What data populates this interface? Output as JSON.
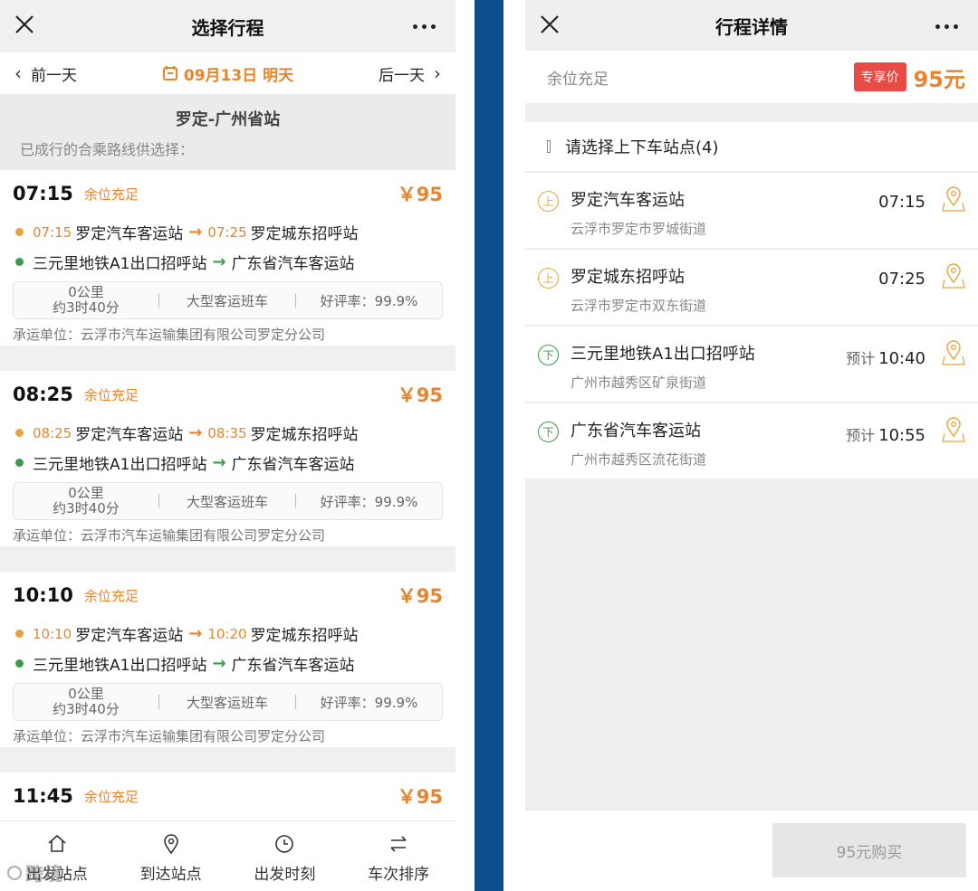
{
  "left": {
    "title": "选择行程",
    "prev_day": "前一天",
    "next_day": "后一天",
    "date": "09月13日 明天",
    "route_title": "罗定-广州省站",
    "route_hint": "已成行的合乘路线供选择：",
    "trips": [
      {
        "time": "07:15",
        "availability": "余位充足",
        "price": "￥95",
        "from_time": "07:15",
        "from": "罗定汽车客运站",
        "mid_time": "07:25",
        "mid": "罗定城东招呼站",
        "drop1": "三元里地铁A1出口招呼站",
        "drop2": "广东省汽车客运站",
        "distance": "0公里",
        "duration": "约3时40分",
        "bus_type": "大型客运班车",
        "rating": "好评率：99.9%",
        "carrier": "承运单位：云浮市汽车运输集团有限公司罗定分公司"
      },
      {
        "time": "08:25",
        "availability": "余位充足",
        "price": "￥95",
        "from_time": "08:25",
        "from": "罗定汽车客运站",
        "mid_time": "08:35",
        "mid": "罗定城东招呼站",
        "drop1": "三元里地铁A1出口招呼站",
        "drop2": "广东省汽车客运站",
        "distance": "0公里",
        "duration": "约3时40分",
        "bus_type": "大型客运班车",
        "rating": "好评率：99.9%",
        "carrier": "承运单位：云浮市汽车运输集团有限公司罗定分公司"
      },
      {
        "time": "10:10",
        "availability": "余位充足",
        "price": "￥95",
        "from_time": "10:10",
        "from": "罗定汽车客运站",
        "mid_time": "10:20",
        "mid": "罗定城东招呼站",
        "drop1": "三元里地铁A1出口招呼站",
        "drop2": "广东省汽车客运站",
        "distance": "0公里",
        "duration": "约3时40分",
        "bus_type": "大型客运班车",
        "rating": "好评率：99.9%",
        "carrier": "承运单位：云浮市汽车运输集团有限公司罗定分公司"
      },
      {
        "time": "11:45",
        "availability": "余位充足",
        "price": "￥95"
      }
    ],
    "tabs": [
      "出发站点",
      "到达站点",
      "出发时刻",
      "车次排序"
    ],
    "watermark": "跨境"
  },
  "right": {
    "title": "行程详情",
    "availability": "余位充足",
    "badge": "专享价",
    "price": "95元",
    "select_header": "请选择上下车站点(4)",
    "stops": [
      {
        "mark": "上",
        "name": "罗定汽车客运站",
        "address": "云浮市罗定市罗城街道",
        "prefix": "",
        "time": "07:15"
      },
      {
        "mark": "上",
        "name": "罗定城东招呼站",
        "address": "云浮市罗定市双东街道",
        "prefix": "",
        "time": "07:25"
      },
      {
        "mark": "下",
        "name": "三元里地铁A1出口招呼站",
        "address": "广州市越秀区矿泉街道",
        "prefix": "预计",
        "time": "10:40"
      },
      {
        "mark": "下",
        "name": "广东省汽车客运站",
        "address": "广州市越秀区流花街道",
        "prefix": "预计",
        "time": "10:55"
      }
    ],
    "buy_button": "95元购买"
  },
  "colors": {
    "accent": "#e8852c",
    "board": "#e8a33c",
    "alight": "#3a9c4a",
    "badge": "#e74b45",
    "separator": "#0f4e8c"
  }
}
